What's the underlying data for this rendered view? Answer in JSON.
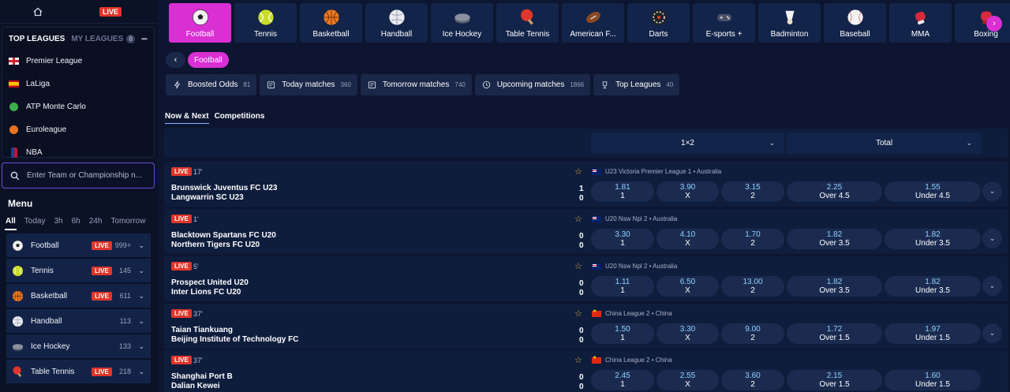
{
  "sidebar": {
    "live_label": "LIVE",
    "tabs": {
      "top": "TOP LEAGUES",
      "my": "MY LEAGUES",
      "my_count": "0"
    },
    "leagues": [
      {
        "label": "Premier League",
        "icon": "england-flag-icon"
      },
      {
        "label": "LaLiga",
        "icon": "spain-flag-icon"
      },
      {
        "label": "ATP Monte Carlo",
        "icon": "tennis-ball-icon"
      },
      {
        "label": "Euroleague",
        "icon": "basketball-icon"
      },
      {
        "label": "NBA",
        "icon": "nba-logo-icon"
      }
    ],
    "search_placeholder": "Enter Team or Championship n...",
    "menu_title": "Menu",
    "time_tabs": [
      "All",
      "Today",
      "3h",
      "6h",
      "24h",
      "Tomorrow"
    ],
    "menu": [
      {
        "label": "Football",
        "live": "LIVE",
        "count": "999+"
      },
      {
        "label": "Tennis",
        "live": "LIVE",
        "count": "145"
      },
      {
        "label": "Basketball",
        "live": "LIVE",
        "count": "611"
      },
      {
        "label": "Handball",
        "live": "",
        "count": "113"
      },
      {
        "label": "Ice Hockey",
        "live": "",
        "count": "133"
      },
      {
        "label": "Table Tennis",
        "live": "LIVE",
        "count": "218"
      }
    ]
  },
  "sports": [
    "Football",
    "Tennis",
    "Basketball",
    "Handball",
    "Ice Hockey",
    "Table Tennis",
    "American F...",
    "Darts",
    "E-sports +",
    "Badminton",
    "Baseball",
    "MMA",
    "Boxing"
  ],
  "breadcrumb": "Football",
  "filters": [
    {
      "label": "Boosted Odds",
      "count": "81"
    },
    {
      "label": "Today matches",
      "count": "360"
    },
    {
      "label": "Tomorrow matches",
      "count": "740"
    },
    {
      "label": "Upcoming matches",
      "count": "1866"
    },
    {
      "label": "Top Leagues",
      "count": "40"
    }
  ],
  "subtabs": [
    "Now & Next",
    "Competitions"
  ],
  "markets": [
    "1×2",
    "Total"
  ],
  "matches": [
    {
      "live": "LIVE",
      "minute": "17'",
      "home": "Brunswick Juventus FC U23",
      "away": "Langwarrin SC U23",
      "score_home": "1",
      "score_away": "0",
      "competition": "U23 Victoria Premier League 1 • Australia",
      "odds": [
        "1.81",
        "3.90",
        "3.15"
      ],
      "labels": [
        "1",
        "X",
        "2"
      ],
      "over": "2.25",
      "over_label": "Over 4.5",
      "under": "1.55",
      "under_label": "Under 4.5"
    },
    {
      "live": "LIVE",
      "minute": "1'",
      "home": "Blacktown Spartans FC U20",
      "away": "Northern Tigers FC U20",
      "score_home": "0",
      "score_away": "0",
      "competition": "U20 Nsw Npl 2 • Australia",
      "odds": [
        "3.30",
        "4.10",
        "1.70"
      ],
      "labels": [
        "1",
        "X",
        "2"
      ],
      "over": "1.82",
      "over_label": "Over 3.5",
      "under": "1.82",
      "under_label": "Under 3.5"
    },
    {
      "live": "LIVE",
      "minute": "5'",
      "home": "Prospect United U20",
      "away": "Inter Lions FC U20",
      "score_home": "0",
      "score_away": "0",
      "competition": "U20 Nsw Npl 2 • Australia",
      "odds": [
        "1.11",
        "6.50",
        "13.00"
      ],
      "labels": [
        "1",
        "X",
        "2"
      ],
      "over": "1.82",
      "over_label": "Over 3.5",
      "under": "1.82",
      "under_label": "Under 3.5"
    },
    {
      "live": "LIVE",
      "minute": "37'",
      "home": "Taian Tiankuang",
      "away": "Beijing Institute of Technology FC",
      "score_home": "0",
      "score_away": "0",
      "competition": "China League 2 • China",
      "odds": [
        "1.50",
        "3.30",
        "9.00"
      ],
      "labels": [
        "1",
        "X",
        "2"
      ],
      "over": "1.72",
      "over_label": "Over 1.5",
      "under": "1.97",
      "under_label": "Under 1.5"
    },
    {
      "live": "LIVE",
      "minute": "37'",
      "home": "Shanghai Port B",
      "away": "Dalian Kewei",
      "score_home": "0",
      "score_away": "0",
      "competition": "China League 2 • China",
      "odds": [
        "2.45",
        "2.55",
        "3.60"
      ],
      "labels": [
        "1",
        "X",
        "2"
      ],
      "over": "2.15",
      "over_label": "Over 1.5",
      "under": "1.60",
      "under_label": "Under 1.5"
    }
  ]
}
